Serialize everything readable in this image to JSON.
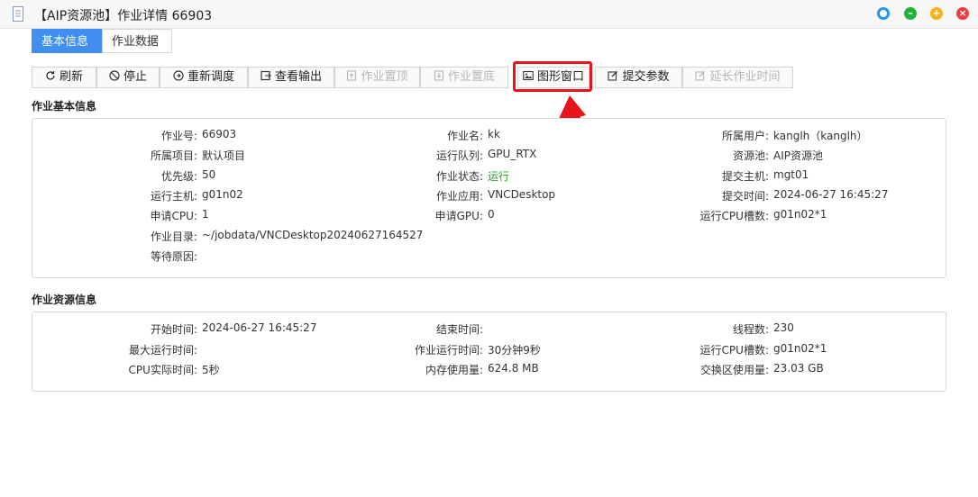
{
  "window": {
    "title": "【AIP资源池】作业详情 66903",
    "buttons": [
      "refresh-window-icon",
      "minimize-icon",
      "maximize-icon",
      "close-icon"
    ]
  },
  "tabs": [
    {
      "label": "基本信息",
      "active": true
    },
    {
      "label": "作业数据",
      "active": false
    }
  ],
  "toolbar": [
    {
      "label": "刷新",
      "icon": "refresh-icon",
      "disabled": false
    },
    {
      "label": "停止",
      "icon": "stop-icon",
      "disabled": false
    },
    {
      "label": "重新调度",
      "icon": "reschedule-icon",
      "disabled": false
    },
    {
      "label": "查看输出",
      "icon": "view-output-icon",
      "disabled": false
    },
    {
      "label": "作业置顶",
      "icon": "pin-top-icon",
      "disabled": true
    },
    {
      "label": "作业置底",
      "icon": "pin-bottom-icon",
      "disabled": true
    },
    {
      "label": "图形窗口",
      "icon": "graphic-window-icon",
      "disabled": false
    },
    {
      "label": "提交参数",
      "icon": "edit-icon",
      "disabled": false
    },
    {
      "label": "延长作业时间",
      "icon": "extend-icon",
      "disabled": true
    }
  ],
  "basic": {
    "title": "作业基本信息",
    "rows": [
      [
        {
          "label": "作业号:",
          "value": "66903"
        },
        {
          "label": "作业名:",
          "value": "kk"
        },
        {
          "label": "所属用户:",
          "value": "kanglh（kanglh）"
        }
      ],
      [
        {
          "label": "所属项目:",
          "value": "默认项目"
        },
        {
          "label": "运行队列:",
          "value": "GPU_RTX"
        },
        {
          "label": "资源池:",
          "value": "AIP资源池"
        }
      ],
      [
        {
          "label": "优先级:",
          "value": "50"
        },
        {
          "label": "作业状态:",
          "value": "运行"
        },
        {
          "label": "提交主机:",
          "value": "mgt01"
        }
      ],
      [
        {
          "label": "运行主机:",
          "value": "g01n02"
        },
        {
          "label": "作业应用:",
          "value": "VNCDesktop"
        },
        {
          "label": "提交时间:",
          "value": "2024-06-27 16:45:27"
        }
      ],
      [
        {
          "label": "申请CPU:",
          "value": "1"
        },
        {
          "label": "申请GPU:",
          "value": "0"
        },
        {
          "label": "运行CPU槽数:",
          "value": "g01n02*1"
        }
      ],
      [
        {
          "label": "作业目录:",
          "value": "~/jobdata/VNCDesktop20240627164527"
        }
      ],
      [
        {
          "label": "等待原因:",
          "value": ""
        }
      ]
    ]
  },
  "resource": {
    "title": "作业资源信息",
    "rows": [
      [
        {
          "label": "开始时间:",
          "value": "2024-06-27 16:45:27"
        },
        {
          "label": "结束时间:",
          "value": ""
        },
        {
          "label": "线程数:",
          "value": "230"
        }
      ],
      [
        {
          "label": "最大运行时间:",
          "value": ""
        },
        {
          "label": "作业运行时间:",
          "value": "30分钟9秒"
        },
        {
          "label": "运行CPU槽数:",
          "value": "g01n02*1"
        }
      ],
      [
        {
          "label": "CPU实际时间:",
          "value": "5秒"
        },
        {
          "label": "内存使用量:",
          "value": "624.8 MB"
        },
        {
          "label": "交换区使用量:",
          "value": "23.03 GB"
        }
      ]
    ]
  },
  "colors": {
    "accent": "#3f8ef0",
    "highlight": "#e8131b",
    "status_running": "#2aa32a"
  }
}
